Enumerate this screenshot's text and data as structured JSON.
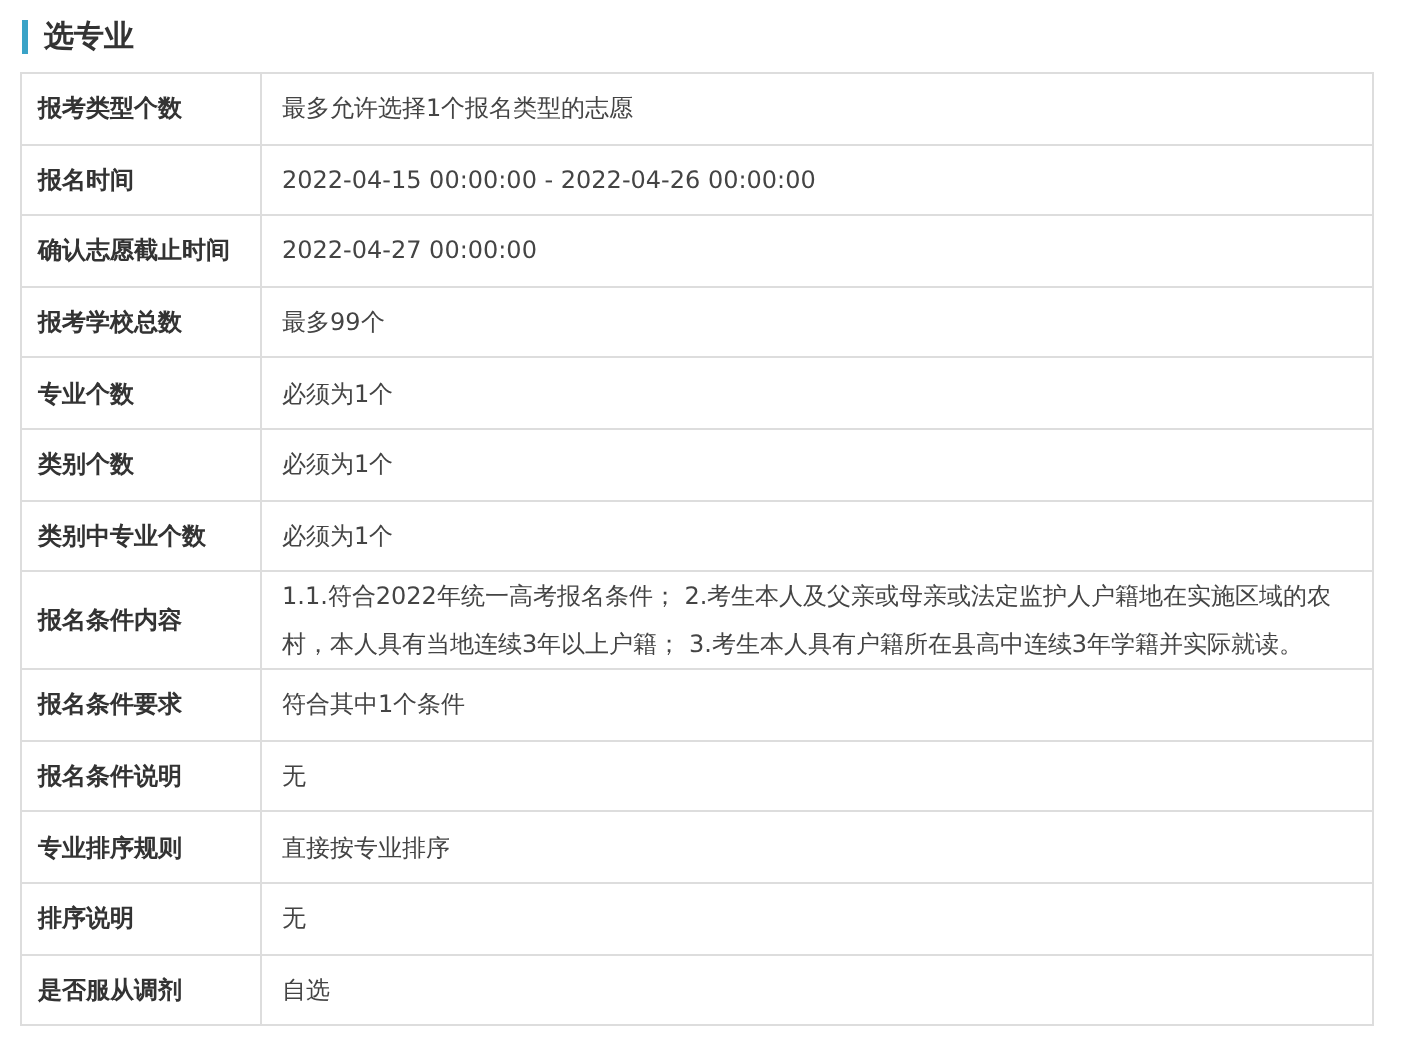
{
  "section": {
    "title": "选专业"
  },
  "rows": [
    {
      "label": "报考类型个数",
      "value": "最多允许选择1个报名类型的志愿"
    },
    {
      "label": "报名时间",
      "value": "2022-04-15 00:00:00 - 2022-04-26 00:00:00"
    },
    {
      "label": "确认志愿截止时间",
      "value": "2022-04-27 00:00:00"
    },
    {
      "label": "报考学校总数",
      "value": "最多99个"
    },
    {
      "label": "专业个数",
      "value": "必须为1个"
    },
    {
      "label": "类别个数",
      "value": "必须为1个"
    },
    {
      "label": "类别中专业个数",
      "value": "必须为1个"
    },
    {
      "label": "报名条件内容",
      "value": "1.1.符合2022年统一高考报名条件； 2.考生本人及父亲或母亲或法定监护人户籍地在实施区域的农村，本人具有当地连续3年以上户籍； 3.考生本人具有户籍所在县高中连续3年学籍并实际就读。"
    },
    {
      "label": "报名条件要求",
      "value": "符合其中1个条件"
    },
    {
      "label": "报名条件说明",
      "value": "无"
    },
    {
      "label": "专业排序规则",
      "value": "直接按专业排序"
    },
    {
      "label": "排序说明",
      "value": "无"
    },
    {
      "label": "是否服从调剂",
      "value": "自选"
    }
  ]
}
